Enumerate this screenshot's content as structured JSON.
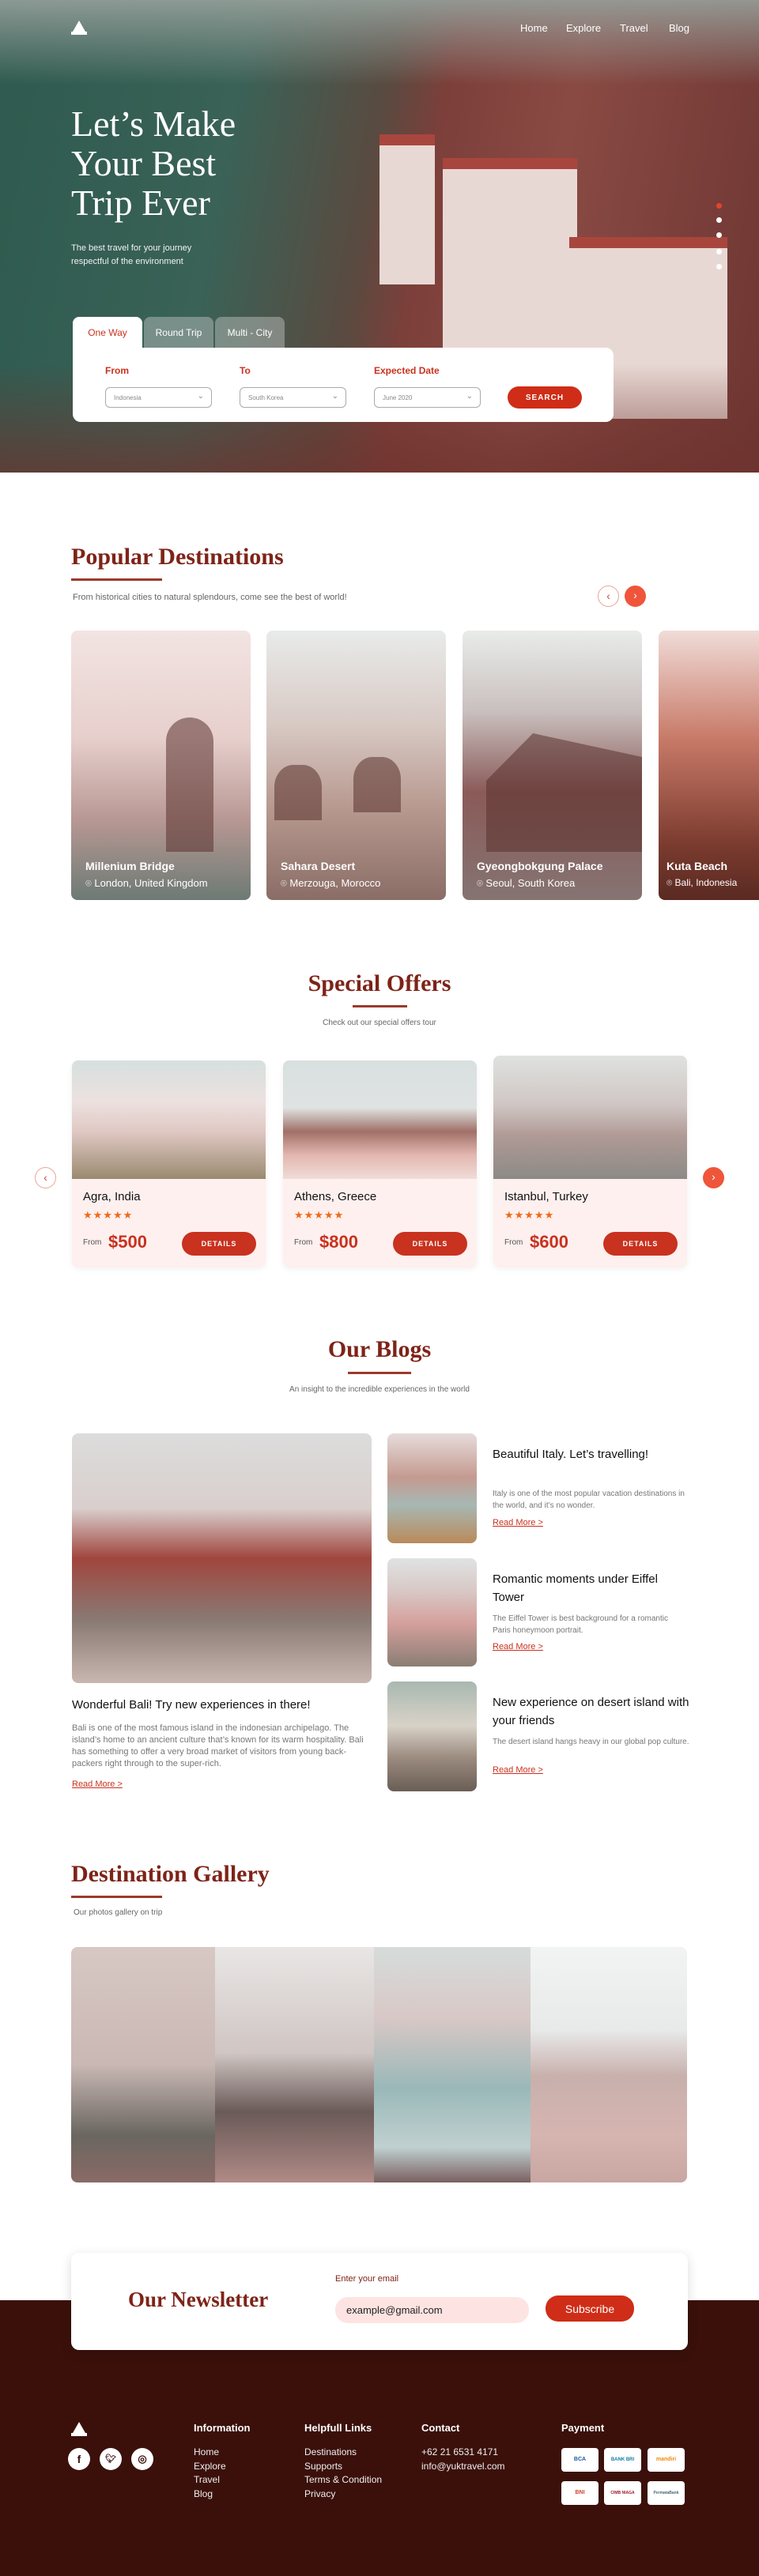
{
  "nav": {
    "items": [
      "Home",
      "Explore",
      "Travel",
      "Blog"
    ]
  },
  "hero": {
    "headline": [
      "Let’s Make",
      "Your Best",
      "Trip Ever"
    ],
    "subtitle": "The best travel for your journey respectful of the environment",
    "slides": 5,
    "active_slide": 1,
    "tabs": [
      "One Way",
      "Round Trip",
      "Multi - City"
    ],
    "active_tab": "One Way",
    "search": {
      "from_label": "From",
      "from_value": "Indonesia",
      "to_label": "To",
      "to_value": "South Korea",
      "date_label": "Expected Date",
      "date_value": "June 2020",
      "button": "SEARCH"
    }
  },
  "popular": {
    "title": "Popular Destinations",
    "subtitle": "From historical cities to natural splendours, come see the best of world!",
    "cards": [
      {
        "name": "Millenium Bridge",
        "location": "London, United Kingdom"
      },
      {
        "name": "Sahara Desert",
        "location": "Merzouga, Morocco"
      },
      {
        "name": "Gyeongbokgung Palace",
        "location": "Seoul, South Korea"
      },
      {
        "name": "Kuta Beach",
        "location": "Bali, Indonesia"
      }
    ]
  },
  "offers": {
    "title": "Special Offers",
    "subtitle": "Check out our special offers tour",
    "cards": [
      {
        "name": "Agra, India",
        "stars": "★★★★★",
        "from": "From",
        "price": "$500",
        "button": "DETAILS"
      },
      {
        "name": "Athens, Greece",
        "stars": "★★★★★",
        "from": "From",
        "price": "$800",
        "button": "DETAILS"
      },
      {
        "name": "Istanbul, Turkey",
        "stars": "★★★★★",
        "from": "From",
        "price": "$600",
        "button": "DETAILS"
      }
    ]
  },
  "blogs": {
    "title": "Our Blogs",
    "subtitle": "An insight to the incredible experiences in the world",
    "featured": {
      "title": "Wonderful Bali! Try new experiences in there!",
      "text": "Bali is one of the most famous island in the indonesian archipelago. The island’s home to an ancient culture that’s known for its warm hospitality. Bali has something to offer a very broad market of visitors from young back-packers right through to the super-rich.",
      "link": "Read More >"
    },
    "posts": [
      {
        "title": "Beautiful Italy. Let’s travelling!",
        "text": "Italy is one of the most popular vacation destinations in the world, and it’s no wonder.",
        "link": "Read More >"
      },
      {
        "title": "Romantic moments under Eiffel Tower",
        "text": "The Eiffel Tower is best background for a romantic Paris honeymoon portrait.",
        "link": "Read More >"
      },
      {
        "title": "New experience on desert island with your friends",
        "text": "The desert island hangs heavy in our global pop culture.",
        "link": "Read More >"
      }
    ]
  },
  "gallery": {
    "title": "Destination Gallery",
    "subtitle": "Our photos gallery on trip"
  },
  "newsletter": {
    "title": "Our Newsletter",
    "label": "Enter your email",
    "value": "example@gmail.com",
    "button": "Subscribe"
  },
  "footer": {
    "social": [
      "facebook-icon",
      "twitter-icon",
      "instagram-icon"
    ],
    "information": {
      "heading": "Information",
      "links": [
        "Home",
        "Explore",
        "Travel",
        "Blog"
      ]
    },
    "helpful": {
      "heading": "Helpfull Links",
      "links": [
        "Destinations",
        "Supports",
        "Terms & Condition",
        "Privacy"
      ]
    },
    "contact": {
      "heading": "Contact",
      "phone": "+62 21 6531 4171",
      "email": "info@yuktravel.com"
    },
    "payment": {
      "heading": "Payment",
      "methods": [
        "BCA",
        "BANK BRI",
        "mandiri",
        "BNI",
        "CIMB NIAGA",
        "PermataBank"
      ]
    }
  },
  "colors": {
    "accent": "#c8321f",
    "heading": "#7e2318",
    "footer": "#3b100b",
    "star": "#f06a15"
  }
}
